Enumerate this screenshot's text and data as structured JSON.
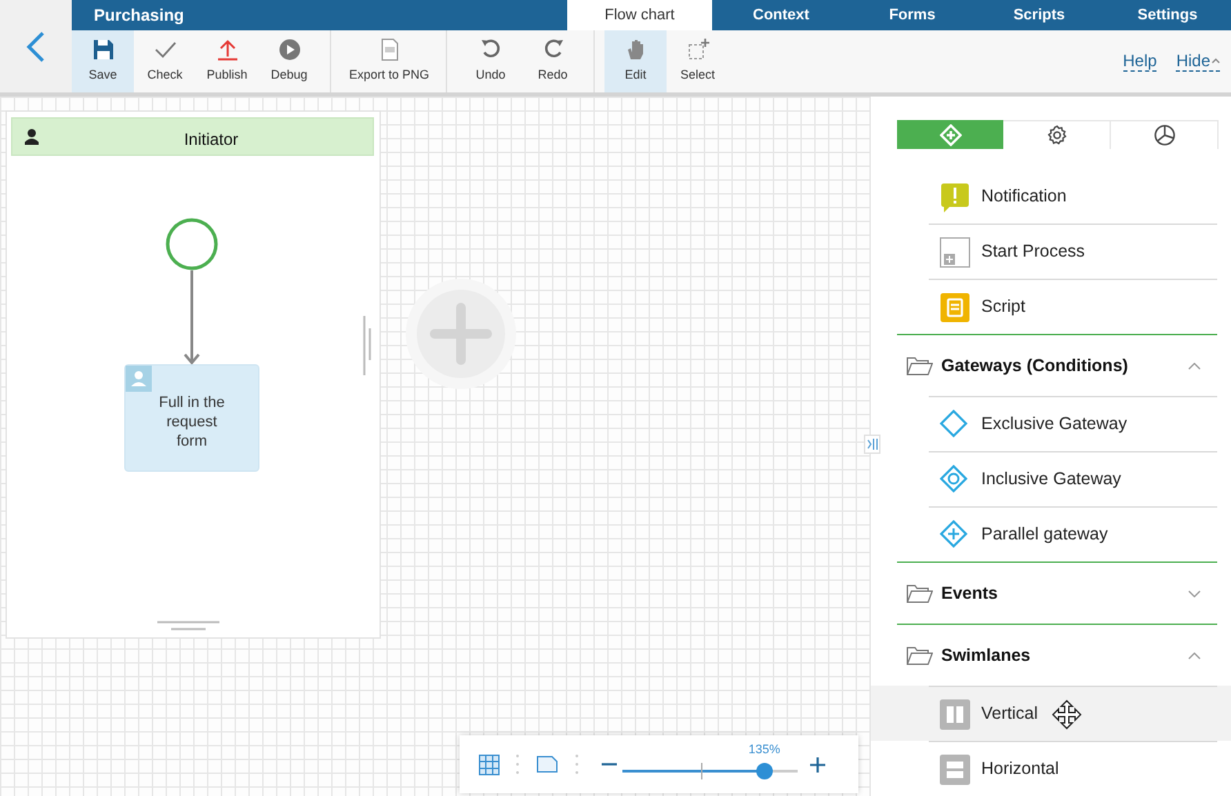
{
  "app": {
    "title": "Purchasing",
    "tabs": [
      {
        "label": "Flow chart",
        "selected": true
      },
      {
        "label": "Context",
        "selected": false
      },
      {
        "label": "Forms",
        "selected": false
      },
      {
        "label": "Scripts",
        "selected": false
      },
      {
        "label": "Settings",
        "selected": false
      }
    ]
  },
  "toolbar": {
    "groups": [
      [
        {
          "kind": "save",
          "label": "Save",
          "selected": true
        },
        {
          "kind": "check",
          "label": "Check",
          "selected": false
        },
        {
          "kind": "publish",
          "label": "Publish",
          "selected": false
        },
        {
          "kind": "debug",
          "label": "Debug",
          "selected": false
        }
      ],
      [
        {
          "kind": "export",
          "label": "Export to PNG",
          "selected": false
        }
      ],
      [
        {
          "kind": "undo",
          "label": "Undo",
          "selected": false
        },
        {
          "kind": "redo",
          "label": "Redo",
          "selected": false
        }
      ],
      [
        {
          "kind": "edit",
          "label": "Edit",
          "selected": true
        },
        {
          "kind": "select",
          "label": "Select",
          "selected": false
        }
      ]
    ],
    "links": [
      {
        "label": "Help",
        "caret": false
      },
      {
        "label": "Hide",
        "caret": true
      }
    ]
  },
  "canvas": {
    "lane": {
      "title": "Initiator"
    },
    "task": {
      "label": "Full in the request form"
    }
  },
  "zoom": {
    "reading": "135%",
    "level": 0.81
  },
  "palette": {
    "tabs": [
      {
        "kind": "elements",
        "selected": true
      },
      {
        "kind": "settings",
        "selected": false
      },
      {
        "kind": "chart",
        "selected": false
      }
    ],
    "sections": [
      {
        "items": [
          {
            "kind": "notification",
            "label": "Notification",
            "hovered": false
          },
          {
            "kind": "start-process",
            "label": "Start Process",
            "hovered": false
          },
          {
            "kind": "script",
            "label": "Script",
            "hovered": false
          }
        ]
      },
      {
        "title": "Gateways (Conditions)",
        "expanded": true,
        "items": [
          {
            "kind": "exclusive",
            "label": "Exclusive Gateway",
            "hovered": false
          },
          {
            "kind": "inclusive",
            "label": "Inclusive Gateway",
            "hovered": false
          },
          {
            "kind": "parallel",
            "label": "Parallel gateway",
            "hovered": false
          }
        ]
      },
      {
        "title": "Events",
        "expanded": false
      },
      {
        "title": "Swimlanes",
        "expanded": true,
        "items": [
          {
            "kind": "vertical",
            "label": "Vertical",
            "hovered": true
          },
          {
            "kind": "horizontal",
            "label": "Horizontal",
            "hovered": false
          }
        ]
      }
    ]
  }
}
